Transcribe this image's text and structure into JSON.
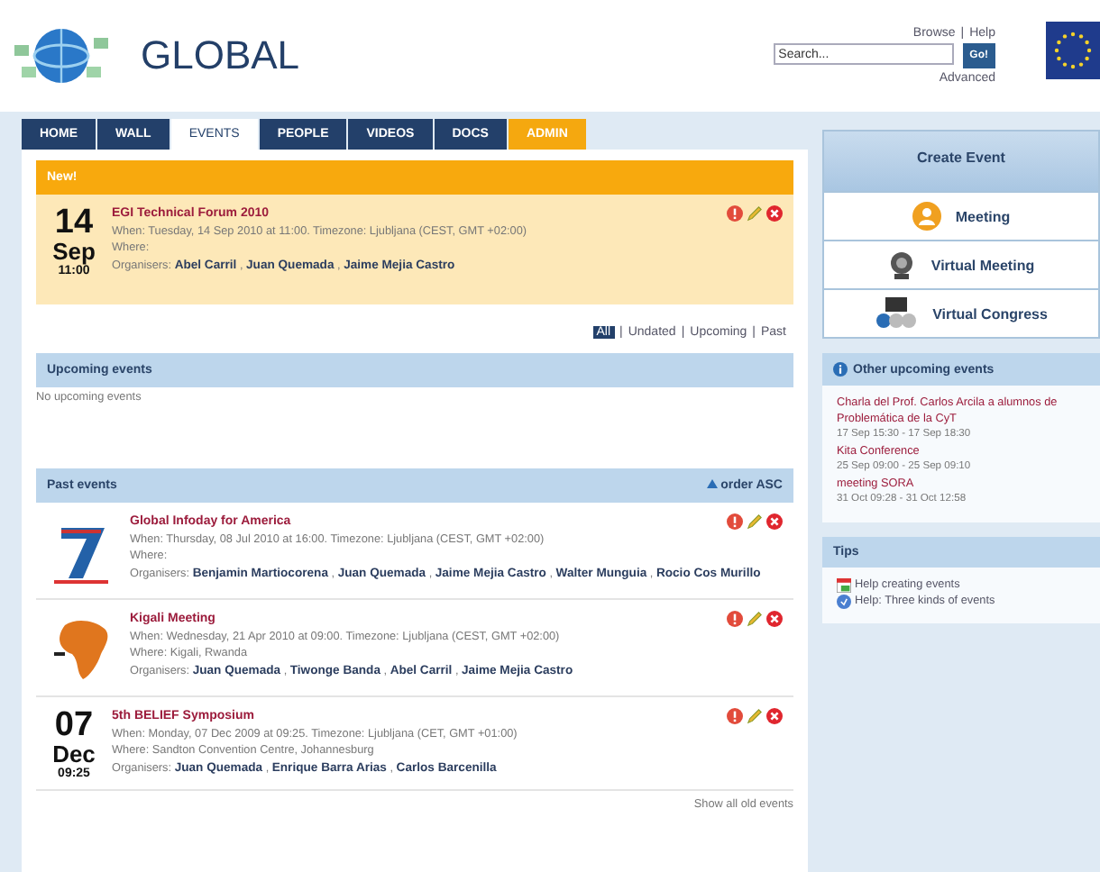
{
  "header": {
    "site_title": "GLOBAL",
    "links": [
      {
        "label": "Browse"
      },
      {
        "label": "Help"
      }
    ],
    "link_separator": "|",
    "search": {
      "placeholder": "Search...",
      "button": "Go!"
    },
    "advanced_link": "Advanced"
  },
  "tabs": [
    {
      "label": "HOME",
      "selected": false,
      "kind": "normal"
    },
    {
      "label": "WALL",
      "selected": false,
      "kind": "normal"
    },
    {
      "label": "EVENTS",
      "selected": true,
      "kind": "normal"
    },
    {
      "label": "PEOPLE",
      "selected": false,
      "kind": "normal"
    },
    {
      "label": "VIDEOS",
      "selected": false,
      "kind": "normal"
    },
    {
      "label": "DOCS",
      "selected": false,
      "kind": "normal"
    },
    {
      "label": "ADMIN",
      "selected": false,
      "kind": "admin"
    }
  ],
  "new_section": {
    "title": "New!",
    "events": [
      {
        "thumb": {
          "kind": "date",
          "day": "14",
          "month": "Sep",
          "time": "11:00"
        },
        "title": "EGI Technical Forum 2010",
        "when": "When: Tuesday, 14 Sep 2010 at 11:00. Timezone: Ljubljana (CEST, GMT +02:00)",
        "where": "Where:",
        "organisers": "Organisers: **Abel Carril** , **Juan Quemada** , **Jaime Mejia Castro**"
      }
    ]
  },
  "filters": {
    "items": [
      {
        "label": "All",
        "selected": true
      },
      {
        "label": "Undated",
        "selected": false
      },
      {
        "label": "Upcoming",
        "selected": false
      },
      {
        "label": "Past",
        "selected": false
      }
    ],
    "separator": "|"
  },
  "upcoming": {
    "title": "Upcoming events",
    "empty_text": "No upcoming events"
  },
  "past": {
    "title": "Past events",
    "order_link": "order ASC",
    "show_all": "Show all old events",
    "events": [
      {
        "thumb": {
          "kind": "logo-blue"
        },
        "title": "Global Infoday for America",
        "when": "When: Thursday, 08 Jul 2010 at 16:00. Timezone: Ljubljana (CEST, GMT +02:00)",
        "where": "Where:",
        "organisers": "Organisers: **Benjamin Martiocorena** , **Juan Quemada** , **Jaime Mejia Castro** , **Walter Munguia** , **Rocio Cos Murillo**"
      },
      {
        "thumb": {
          "kind": "logo-orange"
        },
        "title": "Kigali Meeting",
        "when": "When: Wednesday, 21 Apr 2010 at 09:00. Timezone: Ljubljana (CEST, GMT +02:00)",
        "where": "Where: Kigali, Rwanda",
        "organisers": "Organisers: **Juan Quemada** , **Tiwonge Banda** , **Abel Carril** , **Jaime Mejia Castro**"
      },
      {
        "thumb": {
          "kind": "date",
          "day": "07",
          "month": "Dec",
          "time": "09:25"
        },
        "title": "5th BELIEF Symposium",
        "when": "When: Monday, 07 Dec 2009 at 09:25. Timezone: Ljubljana (CET, GMT +01:00)",
        "where": "Where: Sandton Convention Centre, Johannesburg",
        "organisers": "Organisers: **Juan Quemada** , **Enrique Barra Arias** , **Carlos Barcenilla**"
      }
    ]
  },
  "sidebar": {
    "create_event": {
      "title": "Create Event",
      "items": [
        {
          "label": "Meeting",
          "kind": "meeting"
        },
        {
          "label": "Virtual Meeting",
          "kind": "webcam"
        },
        {
          "label": "Virtual Congress",
          "kind": "congress"
        }
      ]
    },
    "other_upcoming": {
      "title": "Other upcoming events",
      "items": [
        {
          "title": "Charla del Prof. Carlos Arcila a alumnos de Problemática de la CyT",
          "time": "17 Sep 15:30 - 17 Sep 18:30"
        },
        {
          "title": "Kita Conference",
          "time": "25 Sep 09:00 - 25 Sep 09:10"
        },
        {
          "title": "meeting SORA",
          "time": "31 Oct 09:28 - 31 Oct 12:58"
        }
      ]
    },
    "tips": {
      "title": "Tips",
      "items": [
        {
          "label": "Help creating events",
          "kind": "calendar"
        },
        {
          "label": "Help: Three kinds of events",
          "kind": "help"
        }
      ]
    }
  }
}
